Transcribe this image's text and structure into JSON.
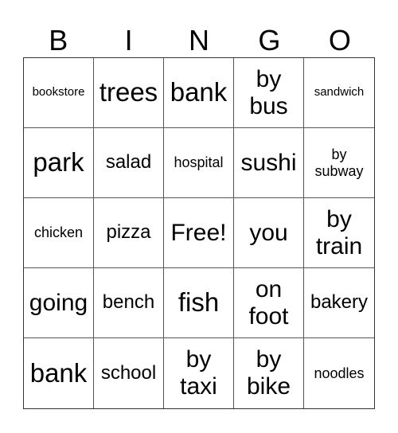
{
  "header": [
    "B",
    "I",
    "N",
    "G",
    "O"
  ],
  "rows": [
    [
      "bookstore",
      "trees",
      "bank",
      "by bus",
      "sandwich"
    ],
    [
      "park",
      "salad",
      "hospital",
      "sushi",
      "by subway"
    ],
    [
      "chicken",
      "pizza",
      "Free!",
      "you",
      "by train"
    ],
    [
      "going",
      "bench",
      "fish",
      "on foot",
      "bakery"
    ],
    [
      "bank",
      "school",
      "by taxi",
      "by bike",
      "noodles"
    ]
  ]
}
